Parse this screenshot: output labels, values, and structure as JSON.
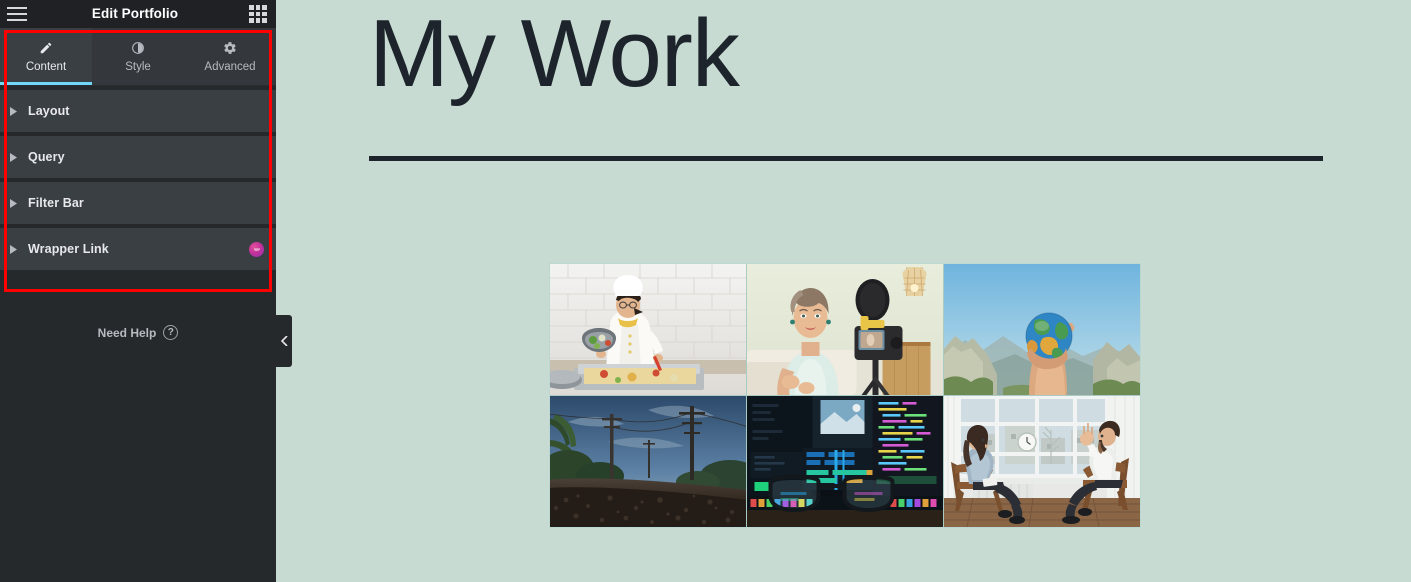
{
  "panel": {
    "header": {
      "title": "Edit Portfolio",
      "menu_icon": "hamburger-menu-icon",
      "apps_icon": "apps-grid-icon"
    },
    "tabs": [
      {
        "label": "Content",
        "icon": "pencil-icon",
        "active": true
      },
      {
        "label": "Style",
        "icon": "contrast-icon",
        "active": false
      },
      {
        "label": "Advanced",
        "icon": "gear-icon",
        "active": false
      }
    ],
    "sections": [
      {
        "label": "Layout",
        "arrow": "chevron-right-icon",
        "badge": null
      },
      {
        "label": "Query",
        "arrow": "chevron-right-icon",
        "badge": null
      },
      {
        "label": "Filter Bar",
        "arrow": "chevron-right-icon",
        "badge": null
      },
      {
        "label": "Wrapper Link",
        "arrow": "chevron-right-icon",
        "badge": "pro-feature-badge"
      }
    ],
    "need_help": {
      "label": "Need Help",
      "icon": "question-mark-circle-icon",
      "symbol": "?"
    },
    "collapse_handle": {
      "icon": "chevron-left-icon"
    }
  },
  "canvas": {
    "heading": "My Work",
    "divider": "horizontal-rule",
    "background_color": "#c7dbd2",
    "text_color": "#1d242c",
    "portfolio": {
      "columns": 3,
      "rows": 2,
      "items": [
        {
          "name": "chef-plating-food",
          "alt": "Chef in white uniform plating food by a subway-tile wall"
        },
        {
          "name": "vlogger-recording-camera",
          "alt": "Woman vlogging in front of a camera on a tripod"
        },
        {
          "name": "hand-holding-globe",
          "alt": "Hand holding a small globe against a blue sky and mountains"
        },
        {
          "name": "roadside-power-lines",
          "alt": "Low-angle gravel road with power lines and palm trees"
        },
        {
          "name": "video-editing-workstation",
          "alt": "Glasses in front of a dark screen with editing and code panels"
        },
        {
          "name": "two-people-interview",
          "alt": "Two people seated in chairs talking by a large window"
        }
      ]
    }
  },
  "annotation": {
    "name": "red-highlight-box",
    "color": "#ff0000"
  }
}
